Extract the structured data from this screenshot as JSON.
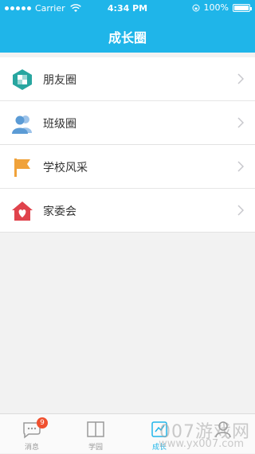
{
  "status_bar": {
    "carrier": "Carrier",
    "time": "4:34 PM",
    "battery": "100%"
  },
  "nav": {
    "title": "成长圈"
  },
  "groups": [
    {
      "items": [
        {
          "label": "朋友圈",
          "icon": "friends-circle-icon",
          "color": "#28a6a0"
        },
        {
          "label": "班级圈",
          "icon": "class-circle-icon",
          "color": "#5b9bd5"
        }
      ]
    },
    {
      "items": [
        {
          "label": "学校风采",
          "icon": "school-flag-icon",
          "color": "#f0a23a"
        },
        {
          "label": "家委会",
          "icon": "parent-committee-icon",
          "color": "#e0434c"
        }
      ]
    }
  ],
  "tabs": [
    {
      "label": "消息",
      "icon": "message-icon",
      "badge": "9"
    },
    {
      "label": "学园",
      "icon": "book-icon"
    },
    {
      "label": "成长",
      "icon": "growth-icon",
      "active": true
    },
    {
      "label": "",
      "icon": "profile-icon"
    }
  ],
  "watermark": {
    "line1": "007游戏网",
    "line2": "www.yx007.com"
  },
  "colors": {
    "accent": "#1fb5e9",
    "badge": "#f0502f"
  }
}
